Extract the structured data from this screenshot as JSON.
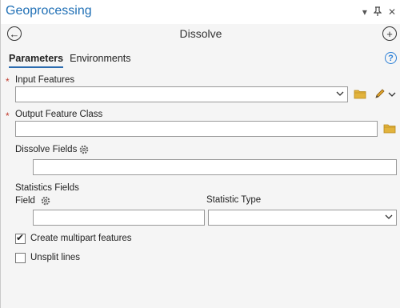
{
  "window": {
    "title": "Geoprocessing"
  },
  "tool": {
    "name": "Dissolve"
  },
  "tabs": [
    "Parameters",
    "Environments"
  ],
  "params": {
    "input_features": {
      "label": "Input Features",
      "value": ""
    },
    "output_feature_class": {
      "label": "Output Feature Class",
      "value": ""
    },
    "dissolve_fields": {
      "label": "Dissolve Fields",
      "value": ""
    },
    "statistics_fields": {
      "label": "Statistics Fields",
      "field_label": "Field",
      "type_label": "Statistic Type",
      "field_value": "",
      "type_value": ""
    },
    "create_multipart": {
      "label": "Create multipart features",
      "checked": true
    },
    "unsplit_lines": {
      "label": "Unsplit lines",
      "checked": false
    }
  },
  "icons": [
    "dropdown-icon",
    "pin-icon",
    "close-icon",
    "back-icon",
    "add-icon",
    "help-icon",
    "folder-icon",
    "pencil-icon",
    "gear-icon",
    "chevron-down-icon"
  ],
  "colors": {
    "title": "#1f6fb5",
    "required": "#c0392b",
    "tab_underline": "#2b6cb0",
    "folder": "#e2b33c"
  }
}
